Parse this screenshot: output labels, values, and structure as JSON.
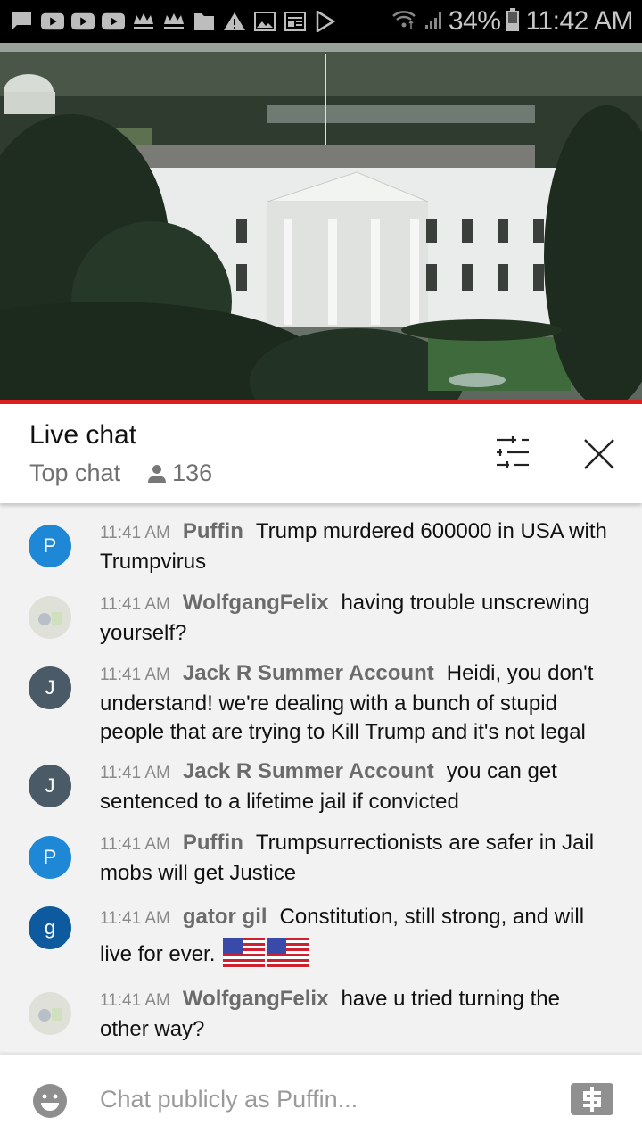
{
  "status_bar": {
    "notification_icons": [
      "chat-bubble-icon",
      "youtube-icon",
      "youtube-icon",
      "youtube-icon",
      "crown-icon",
      "crown-icon",
      "folder-icon",
      "warning-icon",
      "image-icon",
      "news-icon",
      "play-store-icon"
    ],
    "battery": "34%",
    "time": "11:42 AM"
  },
  "video": {
    "description": "Live stream of the White House",
    "progress_color": "#e02020"
  },
  "chat_header": {
    "title": "Live chat",
    "mode": "Top chat",
    "viewer_count": "136"
  },
  "messages": [
    {
      "avatar_letter": "P",
      "avatar_color": "#1e88d6",
      "time": "11:41 AM",
      "author": "Puffin",
      "text": "Trump murdered 600000 in USA with Trumpvirus"
    },
    {
      "avatar_letter": "",
      "avatar_color": "#d8dcd0",
      "time": "11:41 AM",
      "author": "WolfgangFelix",
      "text": "having trouble unscrewing yourself?"
    },
    {
      "avatar_letter": "J",
      "avatar_color": "#4a5a66",
      "time": "11:41 AM",
      "author": "Jack R Summer Account",
      "text": "Heidi, you don't understand! we're dealing with a bunch of stupid people that are trying to Kill Trump and it's not legal"
    },
    {
      "avatar_letter": "J",
      "avatar_color": "#4a5a66",
      "time": "11:41 AM",
      "author": "Jack R Summer Account",
      "text": "you can get sentenced to a lifetime jail if convicted"
    },
    {
      "avatar_letter": "P",
      "avatar_color": "#1e88d6",
      "time": "11:41 AM",
      "author": "Puffin",
      "text": "Trumpsurrectionists are safer in Jail mobs will get Justice"
    },
    {
      "avatar_letter": "g",
      "avatar_color": "#0d5a9e",
      "time": "11:41 AM",
      "author": "gator gil",
      "text": "Constitution, still strong, and will live for ever.",
      "emoji": [
        "us-flag",
        "us-flag"
      ]
    },
    {
      "avatar_letter": "",
      "avatar_color": "#d8dcd0",
      "time": "11:41 AM",
      "author": "WolfgangFelix",
      "text": "have u tried turning the other way?"
    }
  ],
  "input_bar": {
    "placeholder": "Chat publicly as Puffin..."
  }
}
